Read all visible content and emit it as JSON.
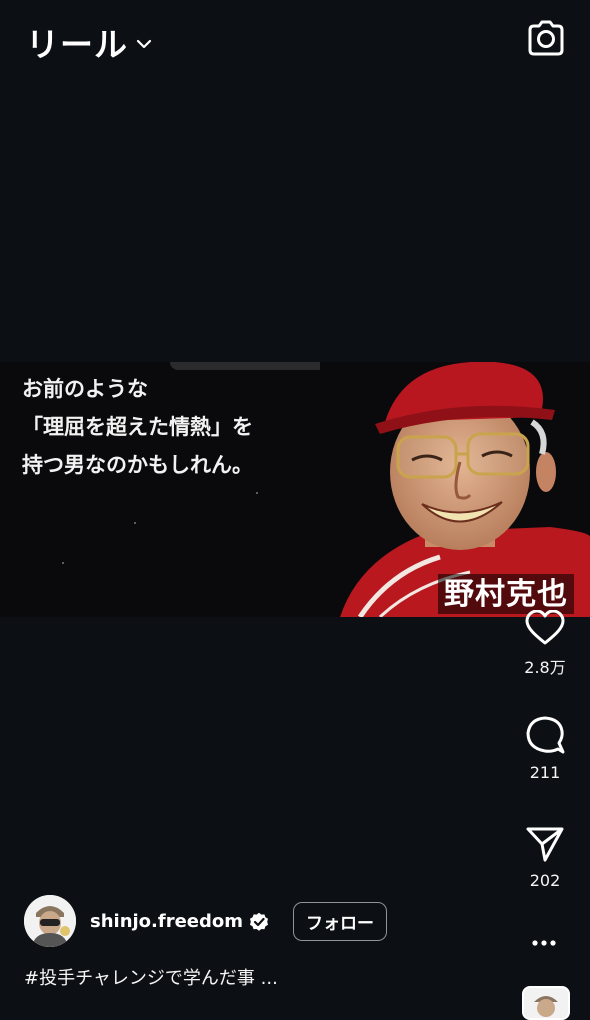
{
  "header": {
    "title": "リール",
    "chevron_icon": "chevron-down-icon",
    "camera_icon": "camera-icon"
  },
  "video": {
    "quote_lines": [
      "お前のような",
      "「理屈を超えた情熱」を",
      "持つ男なのかもしれん。"
    ],
    "name_label": "野村克也"
  },
  "actions": {
    "like_count": "2.8万",
    "comment_count": "211",
    "share_count": "202",
    "like_icon": "heart-icon",
    "comment_icon": "comment-icon",
    "share_icon": "send-icon",
    "more_icon": "more-icon"
  },
  "post": {
    "username": "shinjo.freedom",
    "verified_icon": "verified-badge-icon",
    "follow_label": "フォロー",
    "caption": "#投手チャレンジで学んだ事 ..."
  },
  "colors": {
    "background": "#0c1014",
    "text": "#ffffff"
  }
}
